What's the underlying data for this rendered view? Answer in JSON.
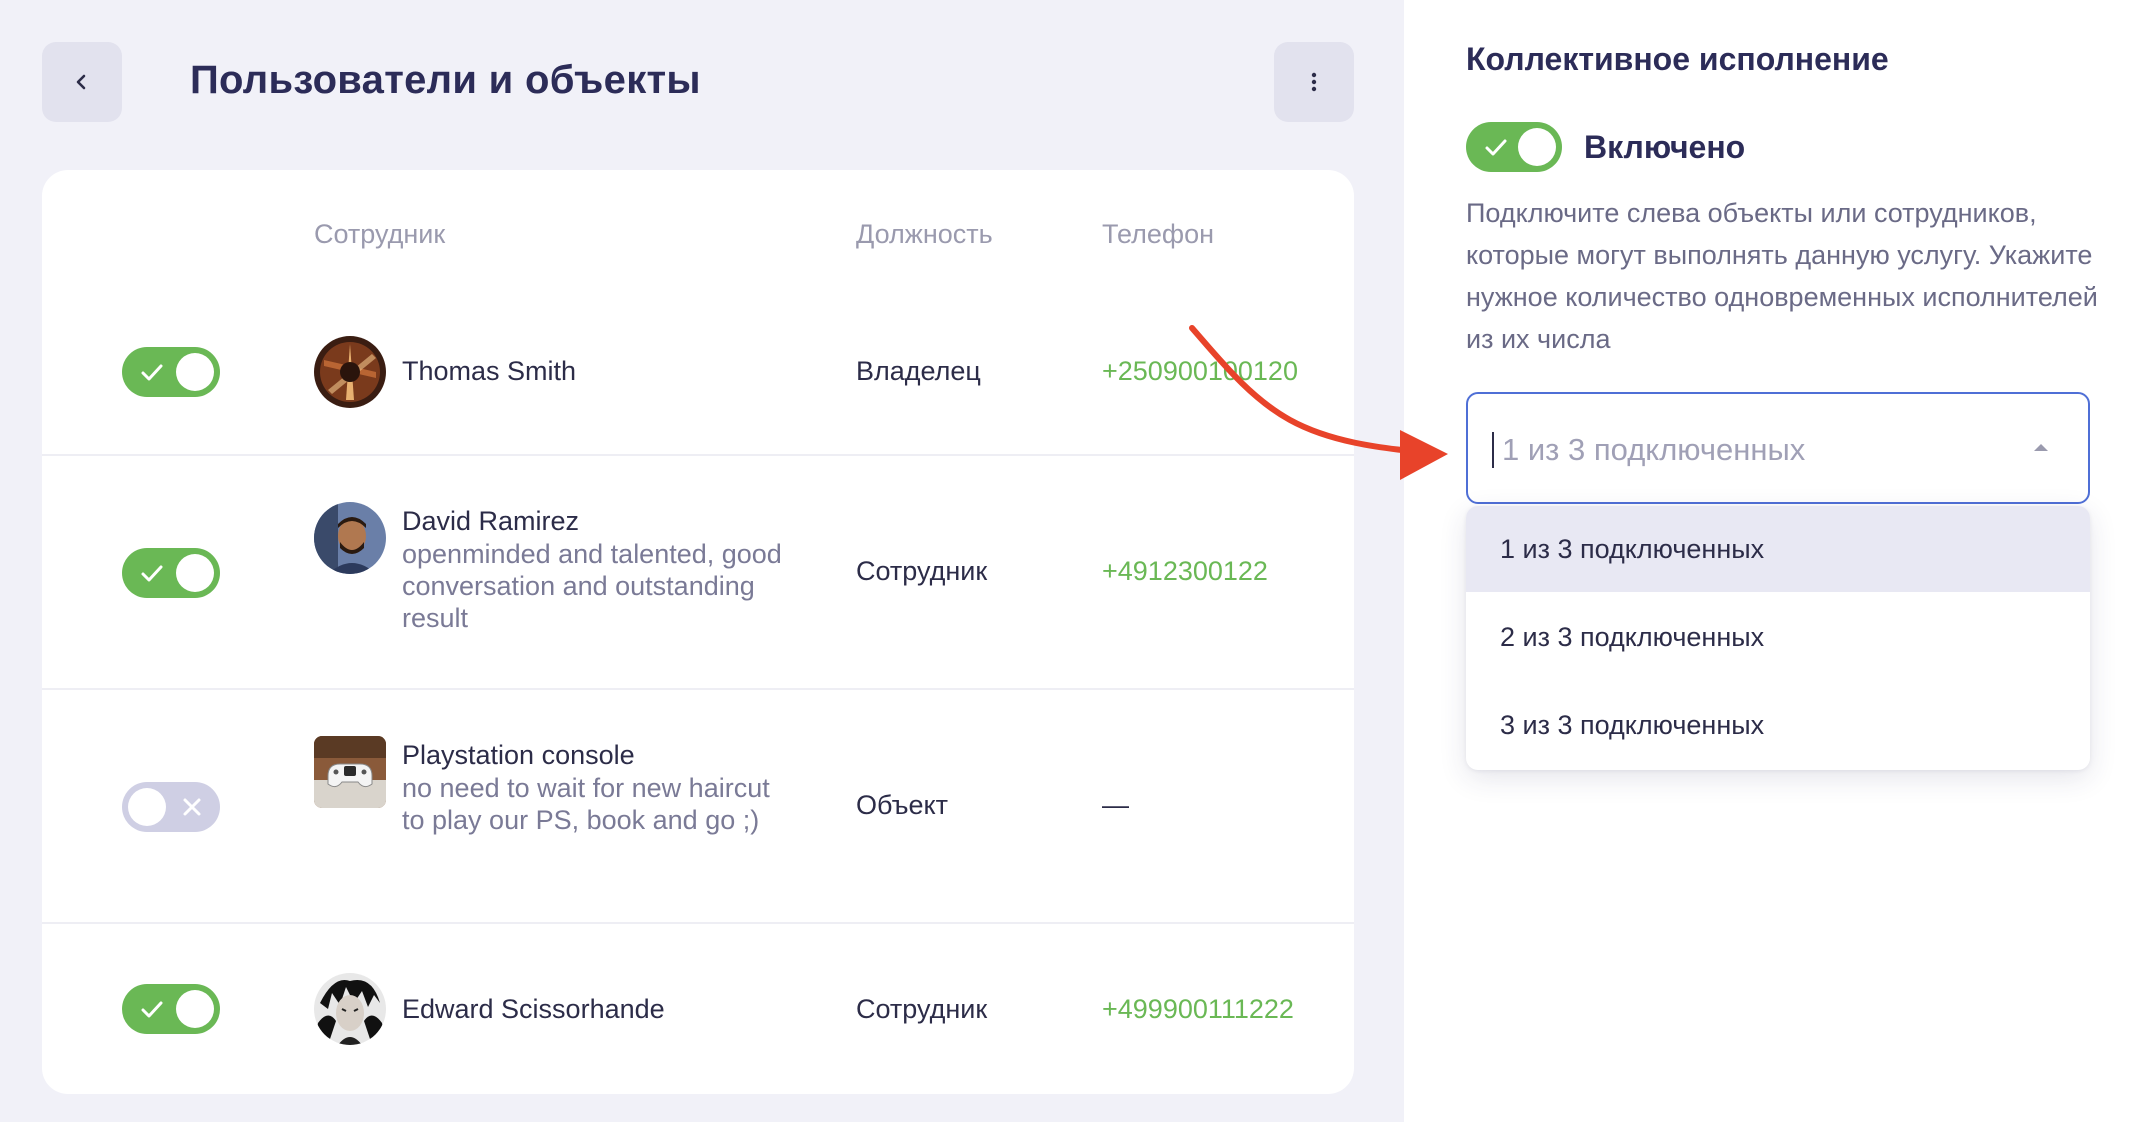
{
  "header": {
    "title": "Пользователи и объекты"
  },
  "table": {
    "columns": {
      "employee": "Сотрудник",
      "position": "Должность",
      "phone": "Телефон"
    },
    "rows": [
      {
        "enabled": true,
        "name": "Thomas Smith",
        "description": "",
        "position": "Владелец",
        "phone": "+250900100120"
      },
      {
        "enabled": true,
        "name": "David Ramirez",
        "description": "openminded and talented, good conversation and outstanding result",
        "position": "Сотрудник",
        "phone": "+4912300122"
      },
      {
        "enabled": false,
        "name": "Playstation console",
        "description": "no need to wait for new haircut to play our PS, book and go ;)",
        "position": "Объект",
        "phone": "—"
      },
      {
        "enabled": true,
        "name": "Edward Scissorhande",
        "description": "",
        "position": "Сотрудник",
        "phone": "+499900111222"
      }
    ]
  },
  "collective": {
    "title": "Коллективное исполнение",
    "enabled": true,
    "enabled_label": "Включено",
    "help_text": "Подключите слева объекты или сотрудников, которые могут выполнять данную услугу. Укажите нужное количество одновременных исполнителей из их числа",
    "select": {
      "value": "1 из 3 подключенных",
      "options": [
        "1 из 3 подключенных",
        "2 из 3 подключенных",
        "3 из 3 подключенных"
      ],
      "selected_index": 0
    }
  },
  "colors": {
    "accent_green": "#6ab855",
    "title_navy": "#2c2c58",
    "focus_blue": "#4f6fd6",
    "annotation_red": "#e8432a",
    "toggle_off": "#cfcfe4"
  },
  "icons": {
    "back": "chevron-left-icon",
    "more": "more-vertical-icon",
    "toggle_on": "check-icon",
    "toggle_off": "x-icon",
    "select": "caret-up-icon"
  }
}
